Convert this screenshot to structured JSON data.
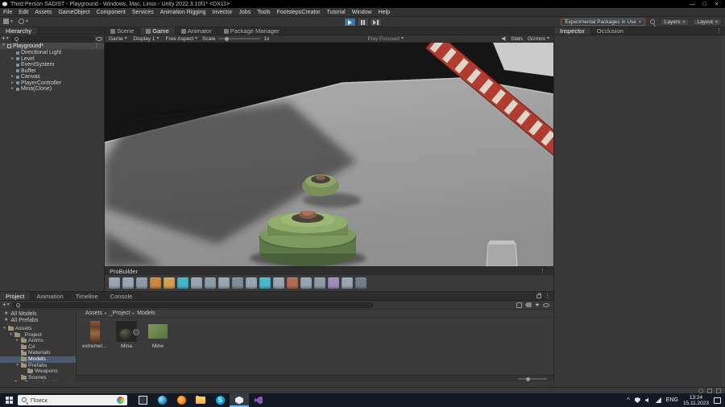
{
  "window": {
    "title": "Third Person SADIST - Playground - Windows, Mac, Linux - Unity 2022.3.10f1* <DX11>"
  },
  "glyphs": {
    "minimize": "—",
    "maximize": "□",
    "close": "×",
    "caret_down": "▾",
    "caret_right": "▸",
    "kebab": "⋮",
    "plus": "+",
    "star": "★",
    "chevron_up": "^"
  },
  "colors": {
    "experimental_border": "#cc3b3b",
    "play_active": "#3e76b0",
    "selection": "#4a5b6f",
    "taskbar_bg": "#141a24"
  },
  "menubar": [
    "File",
    "Edit",
    "Assets",
    "GameObject",
    "Component",
    "Services",
    "Animation Rigging",
    "Invector",
    "Jobs",
    "Tools",
    "FootstepsCreator",
    "Tutorial",
    "Window",
    "Help"
  ],
  "toolbar": {
    "experimental_packages": "Experimental Packages in Use",
    "layers": "Layers",
    "layout": "Layout"
  },
  "hierarchy": {
    "tab": "Hierarchy",
    "scene_name": "Playground*",
    "items": [
      {
        "label": "Directional Light",
        "caret": ""
      },
      {
        "label": "Level",
        "caret": "▸"
      },
      {
        "label": "EventSystem",
        "caret": ""
      },
      {
        "label": "Buffer",
        "caret": ""
      },
      {
        "label": "Canvas",
        "caret": "▸"
      },
      {
        "label": "PlayerController",
        "caret": "▸"
      },
      {
        "label": "Mina(Clone)",
        "caret": "▸"
      }
    ]
  },
  "viewtabs": [
    "Scene",
    "Game",
    "Animator",
    "Package Manager"
  ],
  "game_toolbar": {
    "game": "Game",
    "display": "Display 1",
    "aspect": "Free Aspect",
    "scale_label": "Scale",
    "scale_value": "1x",
    "play_focused": "Play Focused",
    "stats": "Stats",
    "gizmos": "Gizmos"
  },
  "probuilder": {
    "title": "ProBuilder",
    "tools": [
      {
        "name": "new-shape-icon",
        "color": "#98a5b2"
      },
      {
        "name": "new-poly-shape-icon",
        "color": "#98a5b2"
      },
      {
        "name": "smoothing-groups-icon",
        "color": "#8d9aa8"
      },
      {
        "name": "vertex-colors-icon",
        "color": "#c9873f"
      },
      {
        "name": "material-editor-icon",
        "color": "#d2a050"
      },
      {
        "name": "uv-editor-icon",
        "color": "#3fb6c9"
      },
      {
        "name": "mirror-objects-icon",
        "color": "#98a5b2"
      },
      {
        "name": "probuilderize-icon",
        "color": "#8d9aa8"
      },
      {
        "name": "select-hidden-icon",
        "color": "#98a5b2"
      },
      {
        "name": "handle-orientation-icon",
        "color": "#7f8c9a"
      },
      {
        "name": "shift-modifier-icon",
        "color": "#98a5b2"
      },
      {
        "name": "select-by-material-icon",
        "color": "#45b9cd"
      },
      {
        "name": "grow-selection-icon",
        "color": "#98a5b2"
      },
      {
        "name": "shrink-selection-icon",
        "color": "#b06a50"
      },
      {
        "name": "invert-selection-icon",
        "color": "#98a5b2"
      },
      {
        "name": "extrude-faces-icon",
        "color": "#8d9aa8"
      },
      {
        "name": "flip-normals-icon",
        "color": "#9a8fb8"
      },
      {
        "name": "subdivide-object-icon",
        "color": "#98a5b2"
      },
      {
        "name": "center-pivot-icon",
        "color": "#707d8a"
      }
    ]
  },
  "inspector_tabs": [
    "Inspector",
    "Occlusion"
  ],
  "project": {
    "tabs": [
      "Project",
      "Animation",
      "Timeline",
      "Console"
    ],
    "favorites": [
      {
        "icon": "★",
        "label": "All Models"
      },
      {
        "icon": "★",
        "label": "All Prefabs"
      }
    ],
    "tree": [
      {
        "label": "Assets",
        "depth": 0,
        "caret": "▾"
      },
      {
        "label": "_Project",
        "depth": 1,
        "caret": "▾"
      },
      {
        "label": "Anims",
        "depth": 2,
        "caret": "▸"
      },
      {
        "label": "C#",
        "depth": 2,
        "caret": ""
      },
      {
        "label": "Materials",
        "depth": 2,
        "caret": ""
      },
      {
        "label": "Models",
        "depth": 2,
        "caret": "",
        "cls": "selected"
      },
      {
        "label": "Prefabs",
        "depth": 2,
        "caret": "▾"
      },
      {
        "label": "Weapons",
        "depth": 3,
        "caret": ""
      },
      {
        "label": "Scenes",
        "depth": 2,
        "caret": ""
      },
      {
        "label": "_TerrainAutoUpgrade",
        "depth": 1,
        "caret": ""
      }
    ],
    "breadcrumb": [
      {
        "sep": "",
        "label": "Assets"
      },
      {
        "sep": "▸",
        "label": "_Project"
      },
      {
        "sep": "▸",
        "label": "Models"
      }
    ],
    "assets": [
      {
        "label": "extremely...",
        "thumb": "thumb-wood"
      },
      {
        "label": "Mina",
        "thumb": "thumb-mina"
      },
      {
        "label": "Mine",
        "thumb": "thumb-mine"
      }
    ]
  },
  "taskbar": {
    "search_placeholder": "Поиск",
    "apps": [
      {
        "name": "task-view-icon",
        "cls": "app-taskview"
      },
      {
        "name": "edge-browser-icon",
        "cls": "app-edge"
      },
      {
        "name": "firefox-browser-icon",
        "cls": "app-firefox"
      },
      {
        "name": "file-explorer-icon",
        "cls": "app-folder"
      },
      {
        "name": "skype-icon",
        "cls": "app-skype"
      },
      {
        "name": "unity-taskbar-icon",
        "cls": "app-unity active"
      },
      {
        "name": "visual-studio-icon",
        "cls": "app-vs"
      }
    ],
    "lang": "ENG",
    "time": "13:24",
    "date": "15.11.2023"
  }
}
